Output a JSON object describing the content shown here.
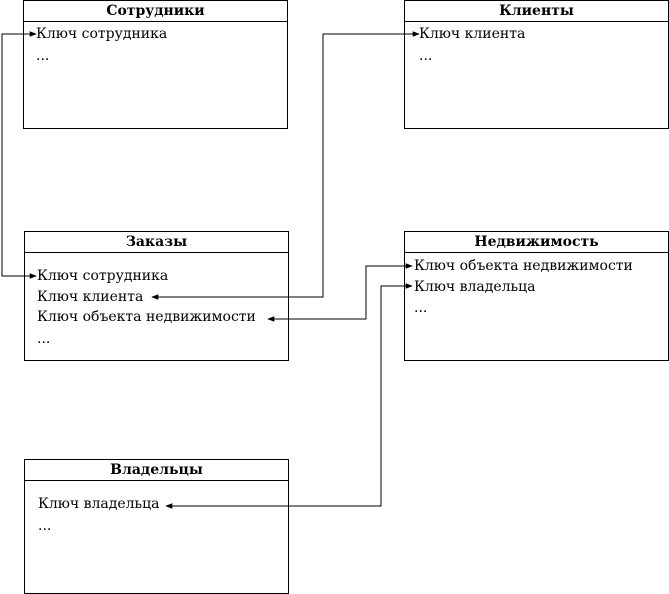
{
  "entities": {
    "employees": {
      "title": "Сотрудники",
      "fields": [
        "Ключ сотрудника",
        "..."
      ]
    },
    "clients": {
      "title": "Клиенты",
      "fields": [
        "Ключ клиента",
        "..."
      ]
    },
    "orders": {
      "title": "Заказы",
      "fields": [
        "Ключ сотрудника",
        "Ключ клиента",
        "Ключ объекта недвижимости",
        "..."
      ]
    },
    "property": {
      "title": "Недвижимость",
      "fields": [
        "Ключ объекта недвижимости",
        "Ключ владельца",
        "..."
      ]
    },
    "owners": {
      "title": "Владельцы",
      "fields": [
        "Ключ владельца",
        "..."
      ]
    }
  },
  "colors": {
    "line": "#000000",
    "background": "#ffffff"
  }
}
